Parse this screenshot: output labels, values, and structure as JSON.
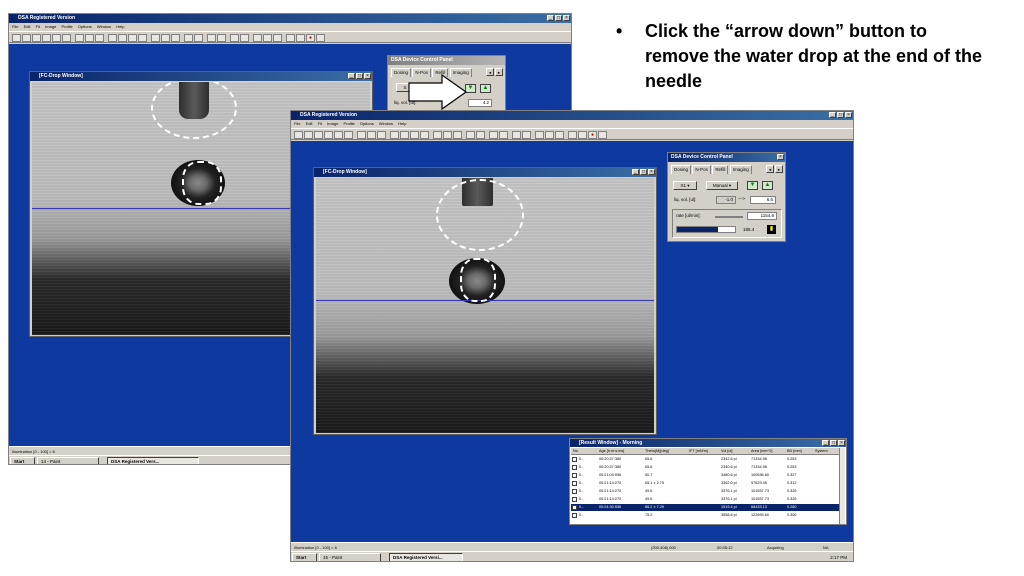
{
  "instruction": {
    "bullet": "•",
    "text": "Click the “arrow down” button to remove the water drop at the end of the needle"
  },
  "back_screenshot": {
    "app_title": "DSA Registered Version",
    "menu": [
      "File",
      "Edit",
      "Fit",
      "Image",
      "Profile",
      "Options",
      "Window",
      "Help"
    ],
    "drop_window_title": "[FC-Drop Window]",
    "panel_title": "DSA Device Control Panel",
    "tabs": [
      "Dosing",
      "N-Pos",
      "Refill",
      "Imaging"
    ],
    "vol_label": "liq. vol. [ul]:",
    "vol_value": "4.2",
    "status_text": "Illumination [0 - 100] = 6",
    "taskbar": {
      "start": "Start",
      "paint": "14 - Paint",
      "dsa": "DSA Registered Vers..."
    }
  },
  "front_screenshot": {
    "app_title": "DSA Registered Version",
    "menu": [
      "File",
      "Edit",
      "Fit",
      "Image",
      "Profile",
      "Options",
      "Window",
      "Help"
    ],
    "drop_window_title": "[FC-Drop Window]",
    "panel": {
      "title": "DSA Device Control Panel",
      "tabs": [
        "Dosing",
        "N-Pos",
        "Refill",
        "Imaging"
      ],
      "dose_mode": "S1",
      "mode": "Manual",
      "vol_label": "liq. vol. [ul]:",
      "vol_current": "-1.0",
      "vol_target": "6.6",
      "rate_label": "rate [ul/min]:",
      "rate_value": "1154.8",
      "progress_value": "185.4"
    },
    "results": {
      "title": "[Result Window] - Morning",
      "columns": [
        "No.",
        "Age [h:m:s:ms]",
        "Theta(M)[deg]",
        "IFT [mN/m]",
        "Vol [ul]",
        "Area [mm^2]",
        "BD [mm]",
        "System"
      ],
      "rows": [
        [
          "0...",
          "00:20:37:360",
          "65.6",
          "",
          "2342.6 pl",
          "71334.98",
          "0.253",
          ""
        ],
        [
          "0...",
          "00:20:37:360",
          "65.6",
          "",
          "2340.6 pl",
          "71334.98",
          "0.253",
          ""
        ],
        [
          "0...",
          "00:21:04:096",
          "50.7",
          "",
          "3480.6 pl",
          "100536.60",
          "0.327",
          ""
        ],
        [
          "0...",
          "00:21:14:270",
          "65.1 ± 2.75",
          "",
          "3362.0 pl",
          "97629.45",
          "0.312",
          ""
        ],
        [
          "0...",
          "00:21:14:270",
          "49.6",
          "",
          "3376.1 pl",
          "101557.73",
          "0.326",
          ""
        ],
        [
          "0...",
          "00:21:14:270",
          "49.6",
          "",
          "3376.1 pl",
          "101557.73",
          "0.326",
          ""
        ],
        [
          "0...",
          "00:24:30:536",
          "86.2 ± 7.29",
          "",
          "1519.4 pl",
          "68433.13",
          "0.280",
          ""
        ],
        [
          "0...",
          "",
          "75.2",
          "",
          "3558.6 pl",
          "122693.60",
          "0.306",
          ""
        ]
      ],
      "selected_row": 6
    },
    "status": {
      "illum": "Illumination [0 - 100] = 6",
      "coords": "(200.408) 000",
      "time": "00:35:12",
      "state": "Acquiring",
      "na": "NA"
    },
    "taskbar": {
      "start": "Start",
      "paint": "15 - Paint",
      "dsa": "DSA Registered Versi...",
      "clock": "2:17 PM"
    }
  },
  "colors": {
    "desktop": "#0e3aa0",
    "titlebar": "#0a246a",
    "chrome": "#d4d0c8",
    "dashed_circle": "#ffffff",
    "selection": "#0a246a"
  },
  "icons": [
    "window-app-icon",
    "minimize-icon",
    "maximize-icon",
    "close-icon",
    "arrow-down-icon",
    "arrow-up-icon",
    "scroll-left-icon",
    "scroll-right-icon",
    "callout-arrow-icon"
  ]
}
